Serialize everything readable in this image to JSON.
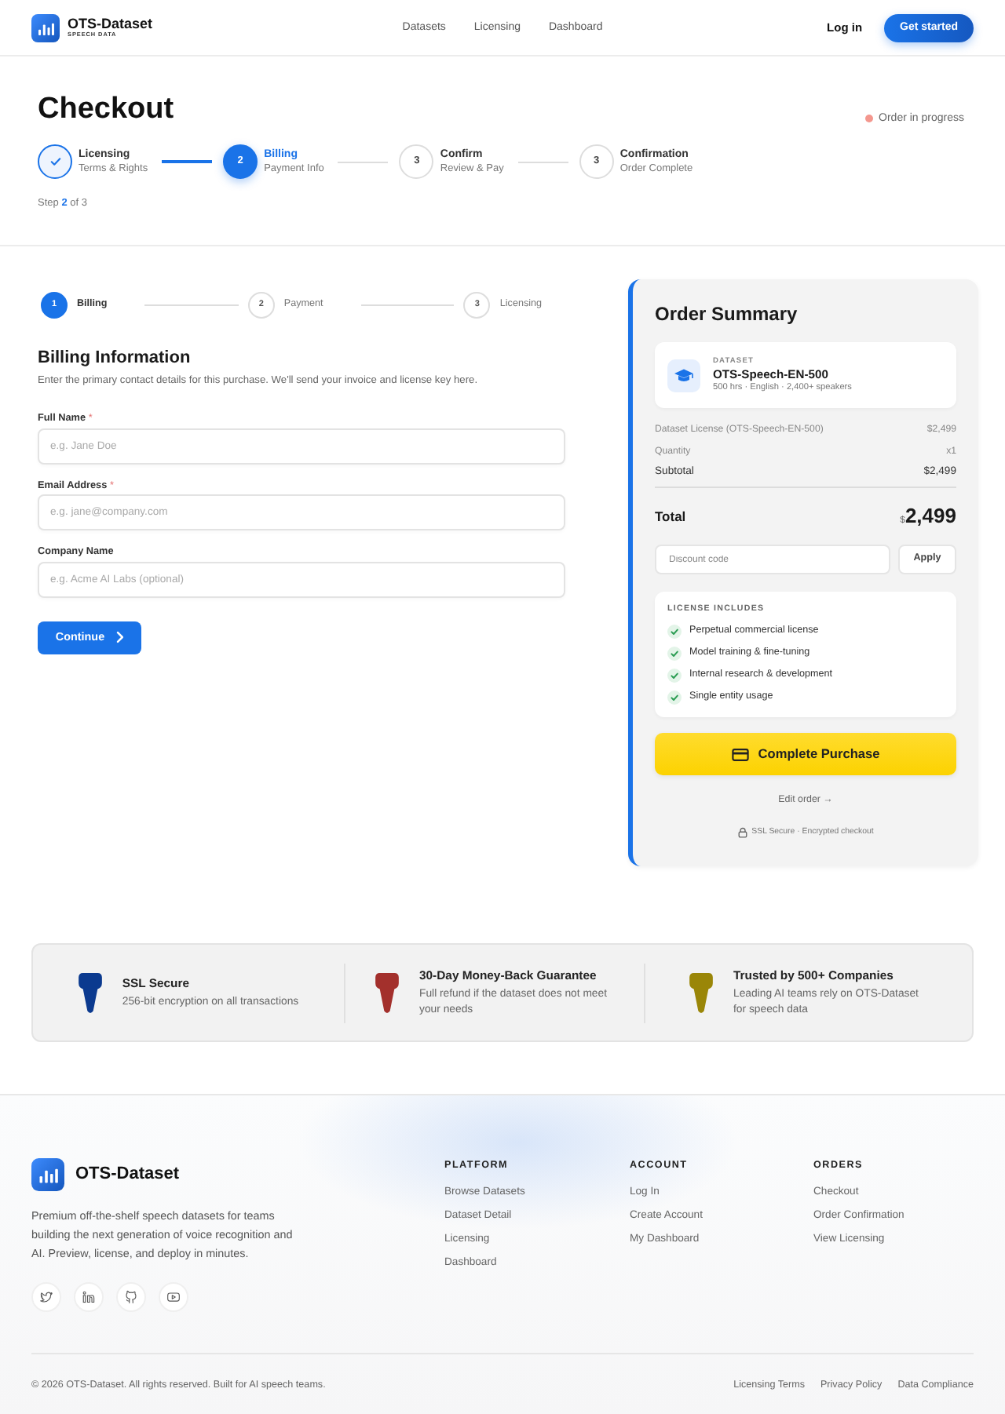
{
  "navbar": {
    "brand": "OTS-Dataset",
    "tagline": "SPEECH DATA",
    "links": [
      "Datasets",
      "Licensing",
      "Dashboard"
    ],
    "login": "Log in",
    "cta": "Get started"
  },
  "header": {
    "title": "Checkout",
    "status": "Order in progress",
    "steps": [
      {
        "label": "Licensing",
        "sublabel": "Terms & Rights",
        "completed": true,
        "selected": false
      },
      {
        "number": "2",
        "label": "Billing",
        "sublabel": "Payment Info",
        "completed": false,
        "selected": true
      },
      {
        "number": "3",
        "label": "Confirm",
        "sublabel": "Review & Pay",
        "completed": false,
        "selected": false
      },
      {
        "number": "3",
        "label": "Confirmation",
        "sublabel": "Order Complete",
        "completed": false,
        "selected": false
      }
    ],
    "step_text": "Step **2** of 3"
  },
  "billing": {
    "steps": [
      {
        "number": "1",
        "label": "Billing",
        "selected": true
      },
      {
        "number": "2",
        "label": "Payment",
        "selected": false
      },
      {
        "number": "3",
        "label": "Licensing",
        "selected": false
      }
    ],
    "title": "Billing Information",
    "description": "Enter the primary contact details for this purchase. We'll send your invoice and license key here.",
    "fields": [
      {
        "label": "Full Name",
        "required_mark": "*",
        "placeholder": "e.g. Jane Doe"
      },
      {
        "label": "Email Address",
        "required_mark": "*",
        "placeholder": "e.g. jane@company.com"
      },
      {
        "label": "Company Name",
        "placeholder": "e.g. Acme AI Labs (optional)"
      }
    ],
    "continue": "Continue"
  },
  "order_summary": {
    "title": "Order Summary",
    "item": {
      "eyebrow": "DATASET",
      "name": "OTS-Speech-EN-500",
      "meta": "500 hrs · English · 2,400+ speakers"
    },
    "lines": [
      {
        "label": "Dataset License (OTS-Speech-EN-500)",
        "value": "$2,499",
        "emphasis": false
      },
      {
        "label": "Quantity",
        "value": "x1",
        "emphasis": false
      },
      {
        "label": "Subtotal",
        "value": "$2,499",
        "emphasis": true
      }
    ],
    "total": {
      "label": "Total",
      "currency": "$",
      "amount": "2,499"
    },
    "discount": {
      "placeholder": "Discount code",
      "button": "Apply"
    },
    "includes": {
      "title": "LICENSE INCLUDES",
      "items": [
        "Perpetual commercial license",
        "Model training & fine-tuning",
        "Internal research & development",
        "Single entity usage"
      ]
    },
    "purchase": "Complete Purchase",
    "edit_link": "Edit order →",
    "secure_note": "SSL Secure · Encrypted checkout"
  },
  "trust": [
    {
      "title": "SSL Secure",
      "text": "256-bit encryption on all transactions",
      "color": "#0b3a8f"
    },
    {
      "title": "30-Day Money-Back Guarantee",
      "text": "Full refund if the dataset does not meet your needs",
      "color": "#a3302c"
    },
    {
      "title": "Trusted by 500+ Companies",
      "text": "Leading AI teams rely on OTS-Dataset for speech data",
      "color": "#9a8608"
    }
  ],
  "footer": {
    "brand": "OTS-Dataset",
    "description": "Premium off-the-shelf speech datasets for teams building the next generation of voice recognition and AI. Preview, license, and deploy in minutes.",
    "socials": [
      {
        "kind": "twitter"
      },
      {
        "kind": "linkedin"
      },
      {
        "kind": "github"
      },
      {
        "kind": "youtube"
      }
    ],
    "columns": [
      {
        "title": "PLATFORM",
        "links": [
          "Browse Datasets",
          "Dataset Detail",
          "Licensing",
          "Dashboard"
        ]
      },
      {
        "title": "ACCOUNT",
        "links": [
          "Log In",
          "Create Account",
          "My Dashboard"
        ]
      },
      {
        "title": "ORDERS",
        "links": [
          "Checkout",
          "Order Confirmation",
          "View Licensing"
        ]
      }
    ],
    "copyright": "© 2026 OTS-Dataset. All rights reserved. Built for AI speech teams.",
    "legal_links": [
      "Licensing Terms",
      "Privacy Policy",
      "Data Compliance"
    ]
  }
}
